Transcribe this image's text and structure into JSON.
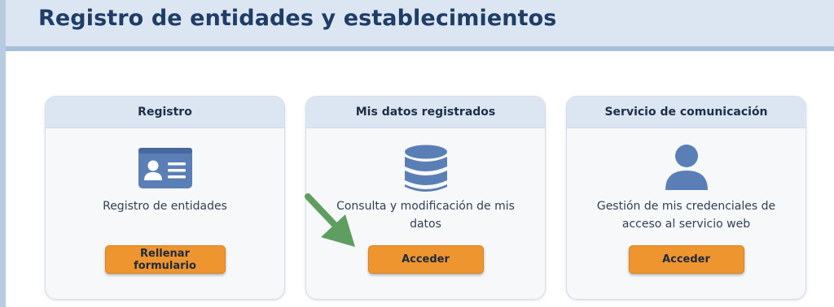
{
  "page": {
    "title": "Registro de entidades y establecimientos"
  },
  "cards": [
    {
      "header": "Registro",
      "icon": "id-card-icon",
      "description": "Registro de entidades",
      "button": "Rellenar formulario"
    },
    {
      "header": "Mis datos registrados",
      "icon": "database-icon",
      "description": "Consulta y modificación de mis datos",
      "button": "Acceder"
    },
    {
      "header": "Servicio de comunicación",
      "icon": "user-icon",
      "description": "Gestión de mis credenciales de acceso al servicio web",
      "button": "Acceder"
    }
  ],
  "annotation": {
    "icon": "green-arrow-icon",
    "color": "#5e9e60"
  },
  "colors": {
    "accent_button": "#ee9530",
    "header_bg": "#dce6f3",
    "title_text": "#1f3d66",
    "icon_blue": "#5a7fb6"
  }
}
